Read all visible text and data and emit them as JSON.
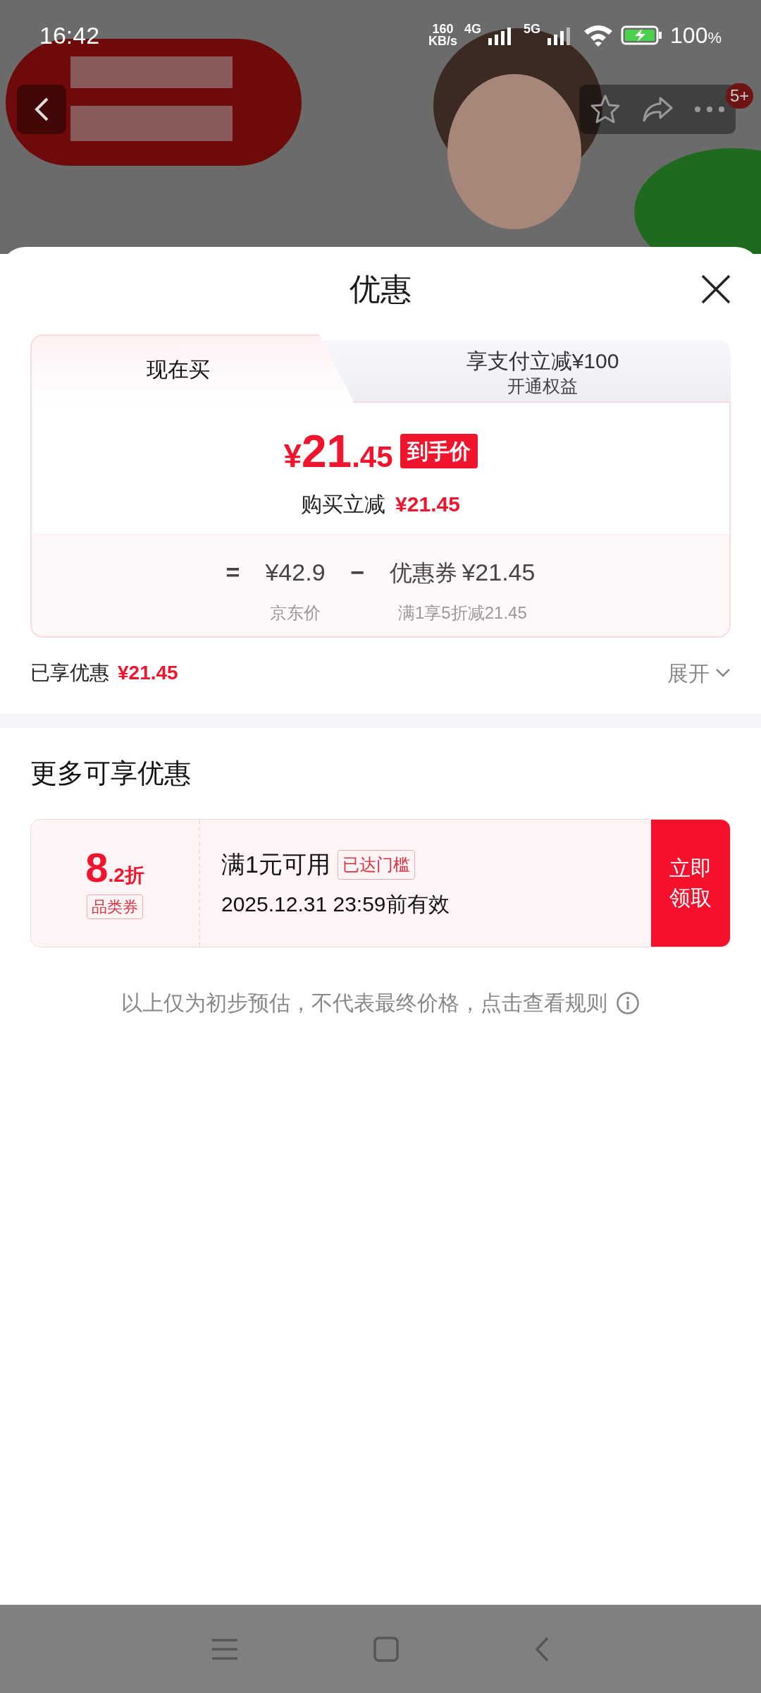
{
  "status_bar": {
    "time": "16:42",
    "net_speed": "160",
    "net_unit": "KB/s",
    "sim1": "4G",
    "sim2": "5G",
    "battery": "100",
    "battery_unit": "%"
  },
  "header": {
    "badge": "5+"
  },
  "sheet": {
    "title": "优惠"
  },
  "tabs": [
    {
      "label": "现在买",
      "selected": true
    },
    {
      "label": "享支付立减¥100",
      "sublabel": "开通权益",
      "selected": false
    }
  ],
  "price": {
    "currency": "¥",
    "integer": "21",
    "decimal": ".45",
    "tag": "到手价",
    "reduction_label": "购买立减",
    "reduction_value": "¥21.45"
  },
  "breakdown": [
    {
      "kind": "operator",
      "text": "="
    },
    {
      "kind": "term",
      "value": "¥42.9",
      "label": "京东价"
    },
    {
      "kind": "operator",
      "text": "−"
    },
    {
      "kind": "term",
      "prefix": "优惠券",
      "value": "¥21.45",
      "label": "满1享5折减21.45"
    }
  ],
  "enjoyed": {
    "label": "已享优惠",
    "value": "¥21.45",
    "expand": "展开"
  },
  "more": {
    "title": "更多可享优惠",
    "coupons": [
      {
        "discount": "8",
        "decimal": ".2",
        "unit": "折",
        "type": "品类券",
        "condition": "满1元可用",
        "tag": "已达门槛",
        "validity": "2025.12.31 23:59前有效",
        "action_line1": "立即",
        "action_line2": "领取"
      }
    ]
  },
  "disclaimer": "以上仅为初步预估，不代表最终价格，点击查看规则"
}
